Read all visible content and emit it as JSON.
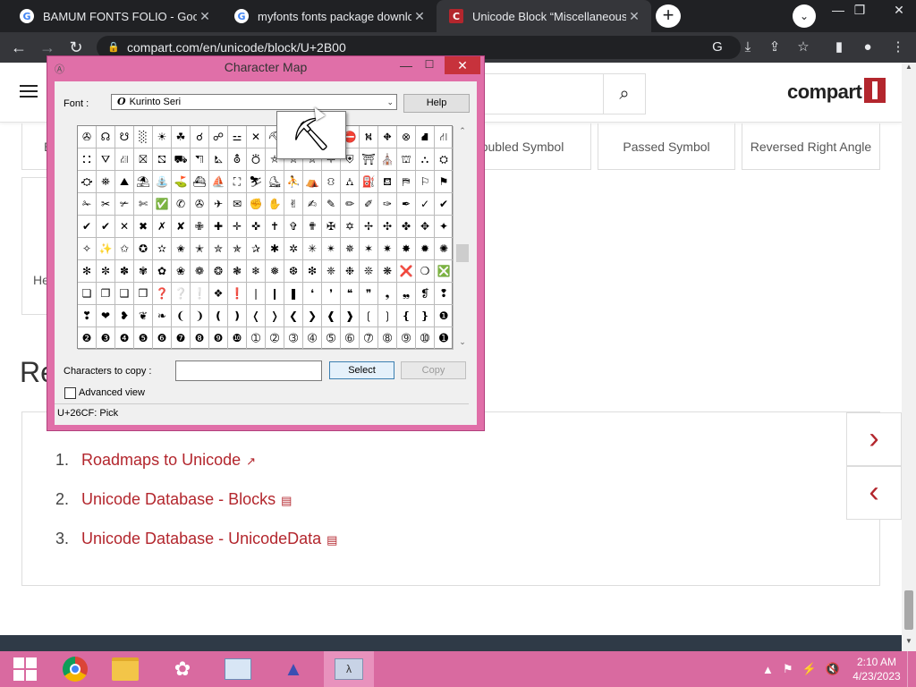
{
  "browser": {
    "tabs": [
      {
        "title": "BAMUM FONTS FOLIO - Google",
        "favicon": "G",
        "close": "✕"
      },
      {
        "title": "myfonts fonts package downloa",
        "favicon": "G",
        "close": "✕"
      },
      {
        "title": "Unicode Block “Miscellaneous Sy",
        "favicon": "C",
        "close": "✕"
      }
    ],
    "new_tab": "+",
    "tab_search": "⌄",
    "url": "compart.com/en/unicode/block/U+2B00",
    "window_controls": {
      "minimize": "—",
      "maximize": "❐",
      "close": "✕"
    }
  },
  "site": {
    "logo": "compart",
    "cards": [
      "oubled Symbol",
      "Passed Symbol",
      "Reversed Right Angle"
    ],
    "ghost_letters": {
      "card_left_top": "E",
      "card_left_mid": "He"
    },
    "related_heading": "Re",
    "references": [
      {
        "num": "1.",
        "label": "Roadmaps to Unicode",
        "icon": "external-link-icon"
      },
      {
        "num": "2.",
        "label": "Unicode Database - Blocks",
        "icon": "document-icon"
      },
      {
        "num": "3.",
        "label": "Unicode Database - UnicodeData",
        "icon": "document-icon"
      }
    ],
    "next_arrow": "›",
    "prev_arrow": "‹"
  },
  "charmap": {
    "title": "Character Map",
    "font_label": "Font :",
    "font_value": "Kurinto Seri",
    "help": "Help",
    "glyphs": [
      "✇",
      "☊",
      "☋",
      "░",
      "☀",
      "☘",
      "☌",
      "☍",
      "⚍",
      "✕",
      "⛏",
      "⛑",
      "⛒",
      "⛓",
      "⛔",
      "⛕",
      "⛖",
      "⊗",
      "⛘",
      "⛙",
      "⛚",
      "⛛",
      "⛜",
      "⛝",
      "⛞",
      "⛟",
      "⛠",
      "⛡",
      "⛢",
      "⛣",
      "⛤",
      "⛥",
      "⛦",
      "⛧",
      "⛨",
      "⛩",
      "⛪",
      "⛫",
      "⛬",
      "⛭",
      "⛮",
      "⛯",
      "⛰",
      "⛱",
      "⛲",
      "⛳",
      "⛴",
      "⛵",
      "⛶",
      "⛷",
      "⛸",
      "⛹",
      "⛺",
      "⛻",
      "⛼",
      "⛽",
      "⛾",
      "⛿",
      "⚐",
      "⚑",
      "✁",
      "✂",
      "✃",
      "✄",
      "✅",
      "✆",
      "✇",
      "✈",
      "✉",
      "✊",
      "✋",
      "✌",
      "✍",
      "✎",
      "✏",
      "✐",
      "✑",
      "✒",
      "✓",
      "✔",
      "✔",
      "✔",
      "✕",
      "✖",
      "✗",
      "✘",
      "✙",
      "✚",
      "✛",
      "✜",
      "✝",
      "✞",
      "✟",
      "✠",
      "✡",
      "✢",
      "✣",
      "✤",
      "✥",
      "✦",
      "✧",
      "✨",
      "✩",
      "✪",
      "✫",
      "✬",
      "✭",
      "✮",
      "✯",
      "✰",
      "✱",
      "✲",
      "✳",
      "✴",
      "✵",
      "✶",
      "✷",
      "✸",
      "✹",
      "✺",
      "✻",
      "✼",
      "✽",
      "✾",
      "✿",
      "❀",
      "❁",
      "❂",
      "❃",
      "❄",
      "❅",
      "❆",
      "❇",
      "❈",
      "❉",
      "❊",
      "❋",
      "❌",
      "❍",
      "❎",
      "❏",
      "❐",
      "❑",
      "❒",
      "❓",
      "❔",
      "❕",
      "❖",
      "❗",
      "❘",
      "❙",
      "❚",
      "❛",
      "❜",
      "❝",
      "❞",
      "❟",
      "❠",
      "❡",
      "❢",
      "❣",
      "❤",
      "❥",
      "❦",
      "❧",
      "❨",
      "❩",
      "❪",
      "❫",
      "❬",
      "❭",
      "❮",
      "❯",
      "❰",
      "❱",
      "❲",
      "❳",
      "❴",
      "❵",
      "❶",
      "❷",
      "❸",
      "❹",
      "❺",
      "❻",
      "❼",
      "❽",
      "❾",
      "❿",
      "➀",
      "➁",
      "➂",
      "➃",
      "➄",
      "➅",
      "➆",
      "➇",
      "➈",
      "➉",
      "➊"
    ],
    "zoom_glyph": "⛏",
    "copy_label": "Characters to copy :",
    "copy_value": "",
    "select": "Select",
    "copy": "Copy",
    "advanced_view": "Advanced view",
    "status": "U+26CF: Pick"
  },
  "taskbar": {
    "clock_time": "2:10 AM",
    "clock_date": "4/23/2023",
    "tray": [
      "▲",
      "⚑",
      "⚡",
      "🔇"
    ]
  }
}
